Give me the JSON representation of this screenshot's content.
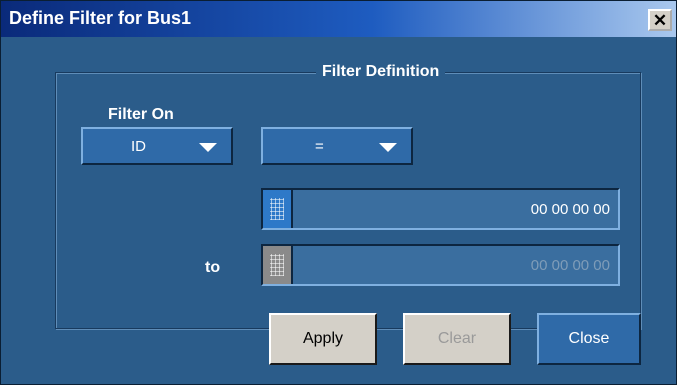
{
  "window": {
    "title": "Define Filter for Bus1",
    "close_glyph": "✕"
  },
  "filter_definition": {
    "group_title": "Filter Definition",
    "filter_on_label": "Filter On",
    "filter_on_value": "ID",
    "operator_value": "=",
    "to_label": "to",
    "value_from": "00 00 00 00",
    "value_to": "00 00 00 00"
  },
  "buttons": {
    "apply": "Apply",
    "clear": "Clear",
    "close": "Close"
  },
  "colors": {
    "panel": "#2b5c8a",
    "control": "#2f6aa8",
    "button_face": "#d4d0c8"
  }
}
